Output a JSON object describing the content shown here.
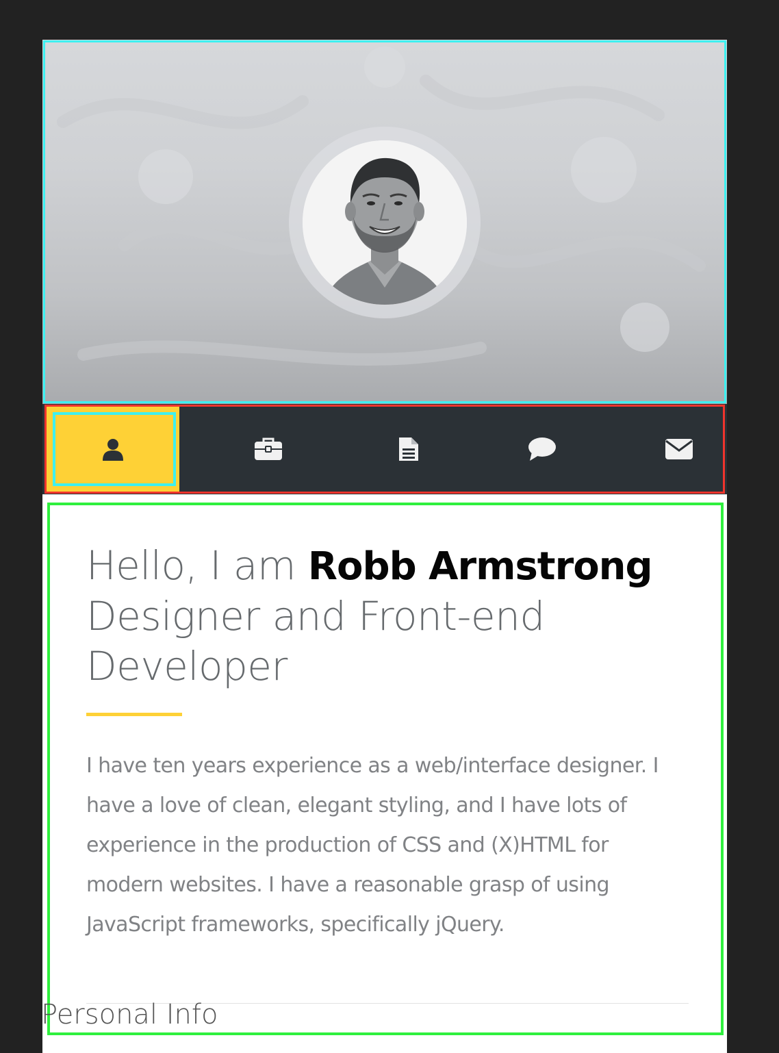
{
  "hero": {
    "avatar_alt": "Robb Armstrong portrait"
  },
  "nav": {
    "items": [
      {
        "id": "about",
        "icon": "user-icon",
        "active": true
      },
      {
        "id": "portfolio",
        "icon": "briefcase-icon",
        "active": false
      },
      {
        "id": "resume",
        "icon": "document-icon",
        "active": false
      },
      {
        "id": "testimonials",
        "icon": "speech-bubble-icon",
        "active": false
      },
      {
        "id": "contact",
        "icon": "envelope-icon",
        "active": false
      }
    ],
    "colors": {
      "bar": "#2b3136",
      "active": "#fed136",
      "icon": "#f1f1f1",
      "active_icon": "#2b3136"
    }
  },
  "intro": {
    "greeting": "Hello, I am ",
    "name": "Robb Armstrong",
    "role": "Designer and Front-end Developer",
    "bio": "I have ten years experience as a web/interface designer. I have a love of clean, elegant styling, and I have lots of experience in the production of CSS and (X)HTML for modern websites. I have a reasonable grasp of using JavaScript frameworks, specifically jQuery."
  },
  "sections": {
    "personal_info_title": "Personal Info"
  },
  "colors": {
    "accent": "#fed136",
    "page_background": "#222222"
  }
}
